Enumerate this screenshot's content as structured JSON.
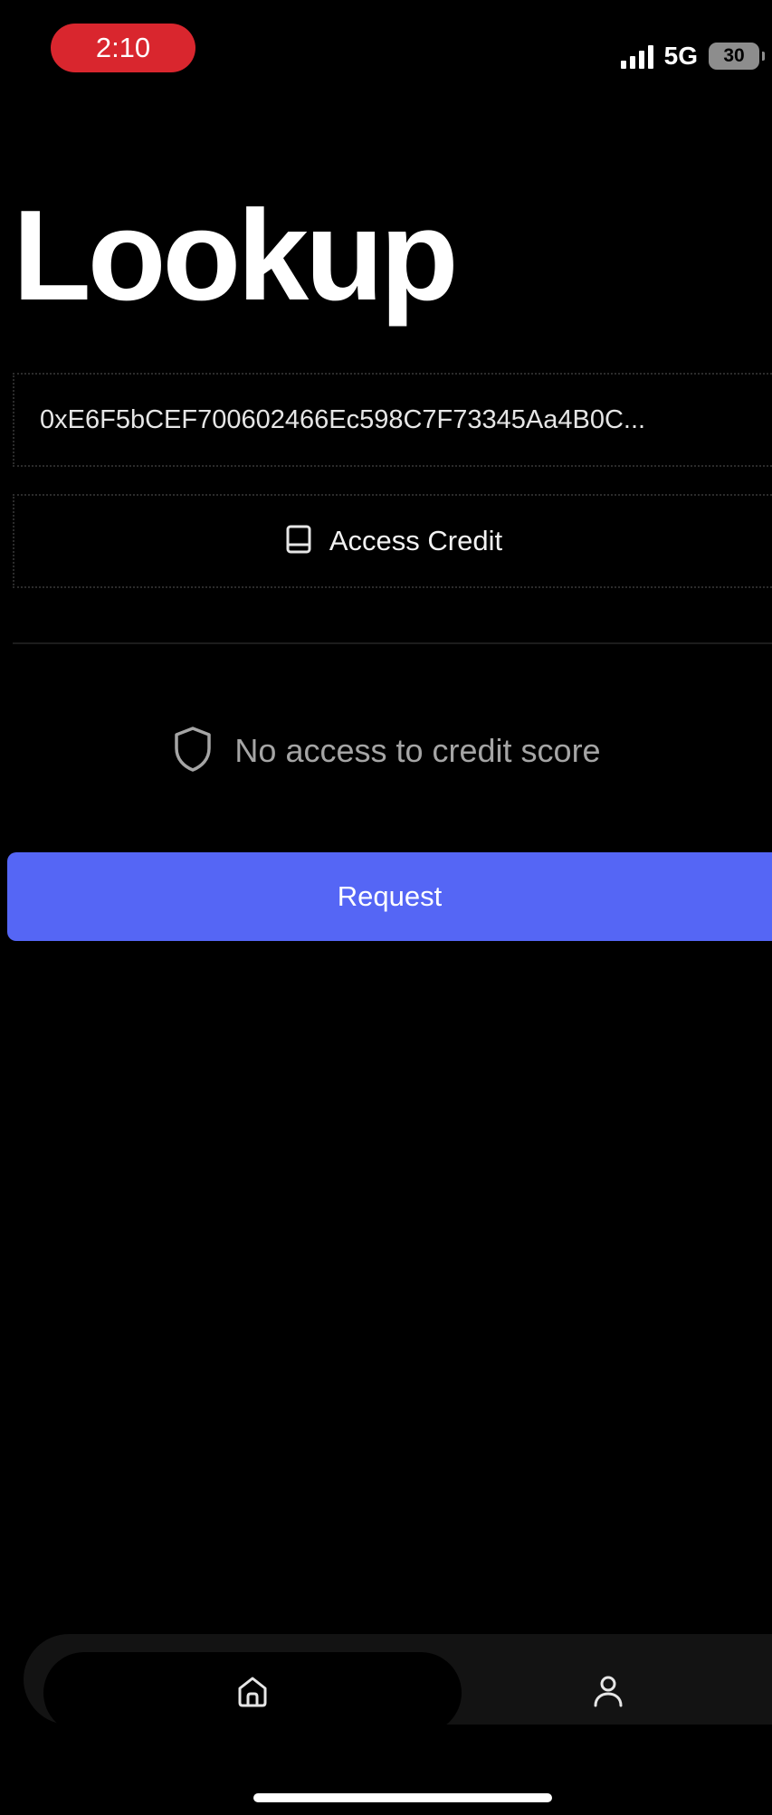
{
  "status_bar": {
    "time": "2:10",
    "network": "5G",
    "battery": "30",
    "colors": {
      "time_pill": "#d9262e"
    }
  },
  "page": {
    "title": "Lookup"
  },
  "address": {
    "value": "0xE6F5bCEF700602466Ec598C7F73345Aa4B0C..."
  },
  "access_credit": {
    "label": "Access Credit",
    "icon": "book-icon"
  },
  "credit_status": {
    "message": "No access to credit score",
    "icon": "shield-icon"
  },
  "request": {
    "label": "Request",
    "color": "#5566f5"
  },
  "tab_bar": {
    "items": [
      {
        "icon": "home-icon",
        "active": true
      },
      {
        "icon": "user-icon",
        "active": false
      }
    ]
  }
}
